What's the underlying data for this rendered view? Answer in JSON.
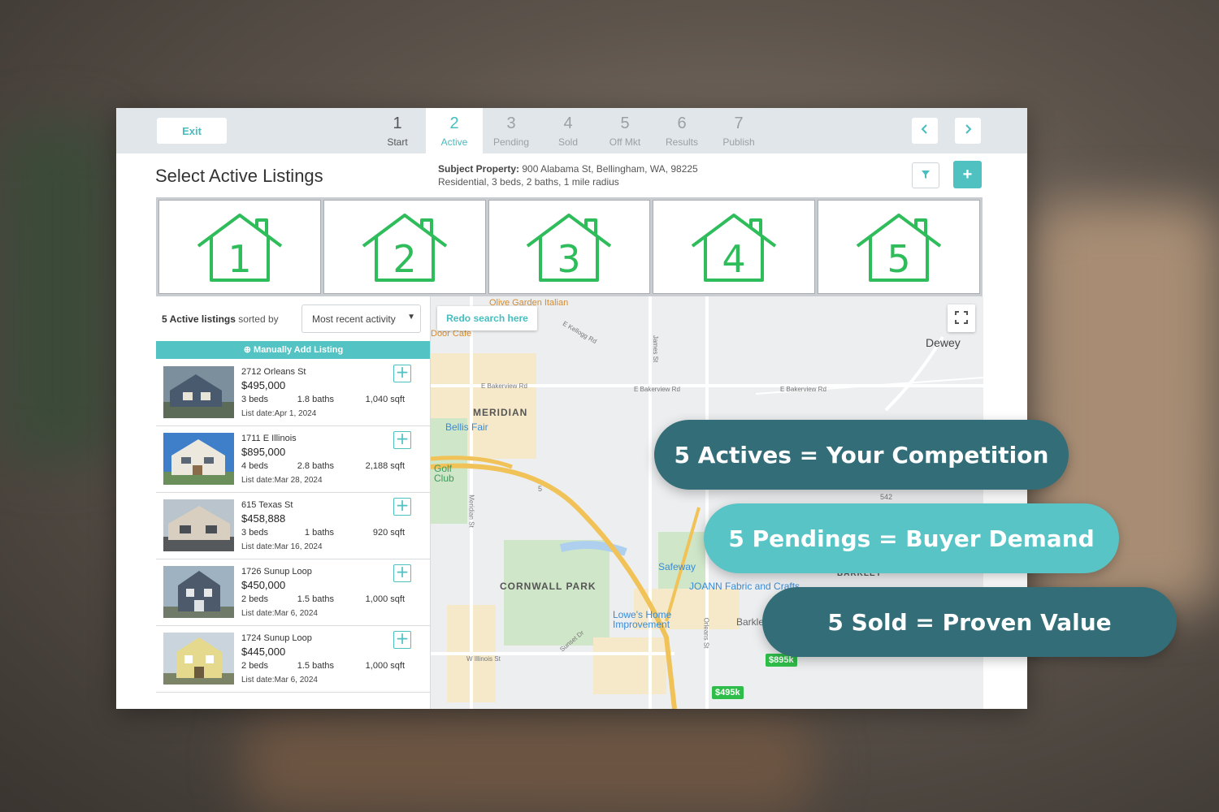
{
  "topbar": {
    "exit_label": "Exit",
    "steps": [
      {
        "num": "1",
        "label": "Start"
      },
      {
        "num": "2",
        "label": "Active"
      },
      {
        "num": "3",
        "label": "Pending"
      },
      {
        "num": "4",
        "label": "Sold"
      },
      {
        "num": "5",
        "label": "Off Mkt"
      },
      {
        "num": "6",
        "label": "Results"
      },
      {
        "num": "7",
        "label": "Publish"
      }
    ],
    "prev_icon": "chevron-left-icon",
    "next_icon": "chevron-right-icon"
  },
  "header": {
    "title": "Select Active Listings",
    "subject_label": "Subject Property:",
    "subject_address": "900 Alabama St, Bellingham, WA, 98225",
    "subject_details": "Residential, 3 beds, 2 baths, 1 mile radius",
    "filter_icon": "filter-icon",
    "add_label": "+"
  },
  "houses": [
    "1",
    "2",
    "3",
    "4",
    "5"
  ],
  "list": {
    "count_label": "5 Active listings",
    "sorted_by": "sorted by",
    "sort_value": "Most recent activity",
    "add_manual_label": "Manually Add Listing",
    "listings": [
      {
        "address": "2712 Orleans St",
        "price": "$495,000",
        "beds": "3",
        "baths": "1.8",
        "sqft": "1,040",
        "date": "Apr 1, 2024"
      },
      {
        "address": "1711 E Illinois",
        "price": "$895,000",
        "beds": "4",
        "baths": "2.8",
        "sqft": "2,188",
        "date": "Mar 28, 2024"
      },
      {
        "address": "615 Texas St",
        "price": "$458,888",
        "beds": "3",
        "baths": "1",
        "sqft": "920",
        "date": "Mar 16, 2024"
      },
      {
        "address": "1726 Sunup Loop",
        "price": "$450,000",
        "beds": "2",
        "baths": "1.5",
        "sqft": "1,000",
        "date": "Mar 6, 2024"
      },
      {
        "address": "1724 Sunup Loop",
        "price": "$445,000",
        "beds": "2",
        "baths": "1.5",
        "sqft": "1,000",
        "date": "Mar 6, 2024"
      }
    ],
    "beds_unit": "beds",
    "baths_unit": "baths",
    "sqft_unit": "sqft",
    "date_prefix": "List date:"
  },
  "map": {
    "redo_label": "Redo search here",
    "labels": {
      "olive_garden": "Olive Garden Italian",
      "door_cafe": "Door Cafe",
      "kellogg": "E Kellogg Rd",
      "james": "James St",
      "dewey": "Dewey",
      "bakerview1": "E Bakerview Rd",
      "bakerview2": "E Bakerview Rd",
      "bakerview3": "E Bakerview Rd",
      "meridian": "MERIDIAN",
      "bellis_fair": "Bellis Fair",
      "golf_club": "Golf Club",
      "meridian_st": "Meridian St",
      "cornwall_park": "CORNWALL PARK",
      "safeway": "Safeway",
      "joann": "JOANN Fabric and Crafts",
      "lowes": "Lowe's Home Improvement",
      "sunset": "Sunset Dr",
      "orleans": "Orleans St",
      "w_illinois": "W Illinois St",
      "barkley": "BARKLEY",
      "barkley2": "Barkle",
      "i5": "5",
      "sr542": "542"
    },
    "pins": [
      "$895k",
      "$495k"
    ]
  },
  "overlay": {
    "actives": "5 Actives = Your Competition",
    "pendings": "5 Pendings = Buyer Demand",
    "sold": "5 Sold = Proven Value"
  },
  "colors": {
    "accent": "#4fc1c1",
    "house_green": "#2ebd5a",
    "pill_dark": "#336d78",
    "pill_light": "#58c4c6"
  }
}
